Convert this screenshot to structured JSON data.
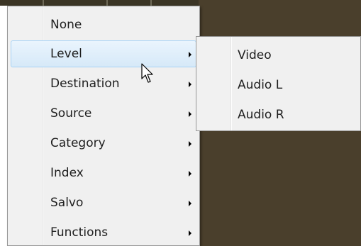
{
  "menu": {
    "items": [
      {
        "label": "None",
        "has_submenu": false
      },
      {
        "label": "Level",
        "has_submenu": true
      },
      {
        "label": "Destination",
        "has_submenu": true
      },
      {
        "label": "Source",
        "has_submenu": true
      },
      {
        "label": "Category",
        "has_submenu": true
      },
      {
        "label": "Index",
        "has_submenu": true
      },
      {
        "label": "Salvo",
        "has_submenu": true
      },
      {
        "label": "Functions",
        "has_submenu": true
      }
    ],
    "highlighted": "Level"
  },
  "submenu": {
    "items": [
      {
        "label": "Video"
      },
      {
        "label": "Audio L"
      },
      {
        "label": "Audio R"
      }
    ]
  },
  "colors": {
    "background_dark": "#4a3f2c",
    "menu_background": "#f0f0f0",
    "highlight_border": "#a8d3f6",
    "highlight_fill": "#d6e9f8"
  },
  "icons": {
    "submenu_arrow": "chevron-right-icon",
    "cursor": "mouse-pointer-icon"
  }
}
